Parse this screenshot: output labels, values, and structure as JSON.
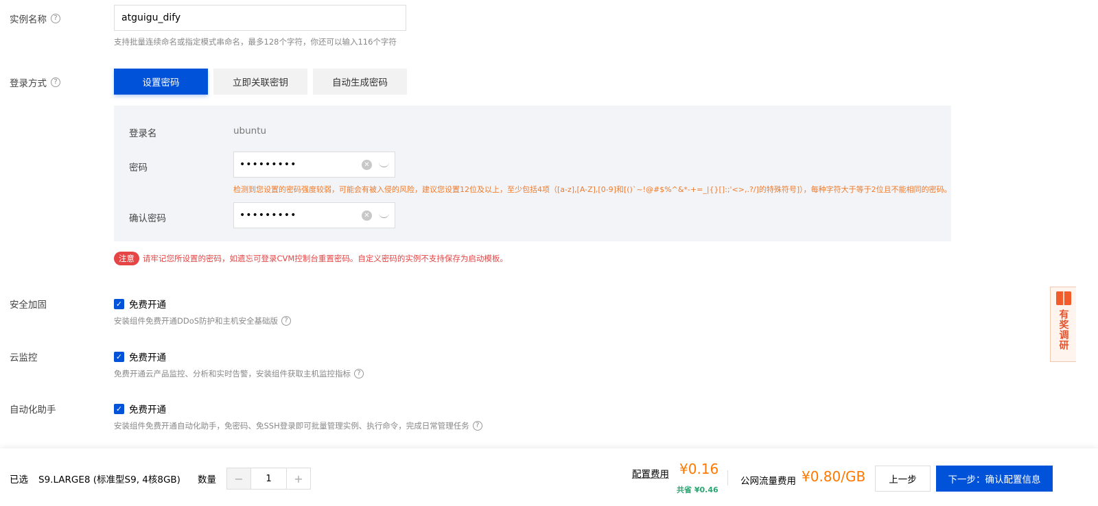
{
  "instance_name": {
    "label": "实例名称",
    "value": "atguigu_dify",
    "hint": "支持批量连续命名或指定模式串命名，最多128个字符，你还可以输入116个字符"
  },
  "login": {
    "label": "登录方式",
    "tabs": [
      {
        "label": "设置密码",
        "active": true
      },
      {
        "label": "立即关联密钥",
        "active": false
      },
      {
        "label": "自动生成密码",
        "active": false
      }
    ],
    "username_label": "登录名",
    "username": "ubuntu",
    "password_label": "密码",
    "password_value": "•••••••••",
    "confirm_label": "确认密码",
    "confirm_value": "•••••••••",
    "warning": "检测到您设置的密码强度较弱，可能会有被入侵的风险，建议您设置12位及以上，至少包括4项（[a-z],[A-Z],[0-9]和[()`~!@#$%^&*-+=_|{}[]:;'<>,.?/]的特殊符号]），每种字符大于等于2位且不能相同的密码。",
    "notice_badge": "注意",
    "notice_text": "请牢记您所设置的密码，如遗忘可登录CVM控制台重置密码。自定义密码的实例不支持保存为启动模板。"
  },
  "security": {
    "label": "安全加固",
    "check_label": "免费开通",
    "hint": "安装组件免费开通DDoS防护和主机安全基础版"
  },
  "monitor": {
    "label": "云监控",
    "check_label": "免费开通",
    "hint": "免费开通云产品监控、分析和实时告警，安装组件获取主机监控指标"
  },
  "automation": {
    "label": "自动化助手",
    "check_label": "免费开通",
    "hint": "安装组件免费开通自动化助手，免密码、免SSH登录即可批量管理实例、执行命令，完成日常管理任务"
  },
  "survey": {
    "text": "有奖调研"
  },
  "footer": {
    "selected_label": "已选",
    "spec": "S9.LARGE8 (标准型S9, 4核8GB)",
    "qty_label": "数量",
    "qty_minus": "−",
    "qty_value": "1",
    "qty_plus": "+",
    "config_fee_label": "配置费用",
    "config_fee": "¥0.16",
    "savings": "共省 ¥0.46",
    "net_fee_label": "公网流量费用",
    "net_fee": "¥0.80/GB",
    "prev_label": "上一步",
    "next_label": "下一步：确认配置信息"
  },
  "colors": {
    "primary": "#0052d9",
    "warning": "#ed7b2f",
    "error": "#e54545",
    "price": "#ff7800",
    "success": "#2ba471"
  }
}
